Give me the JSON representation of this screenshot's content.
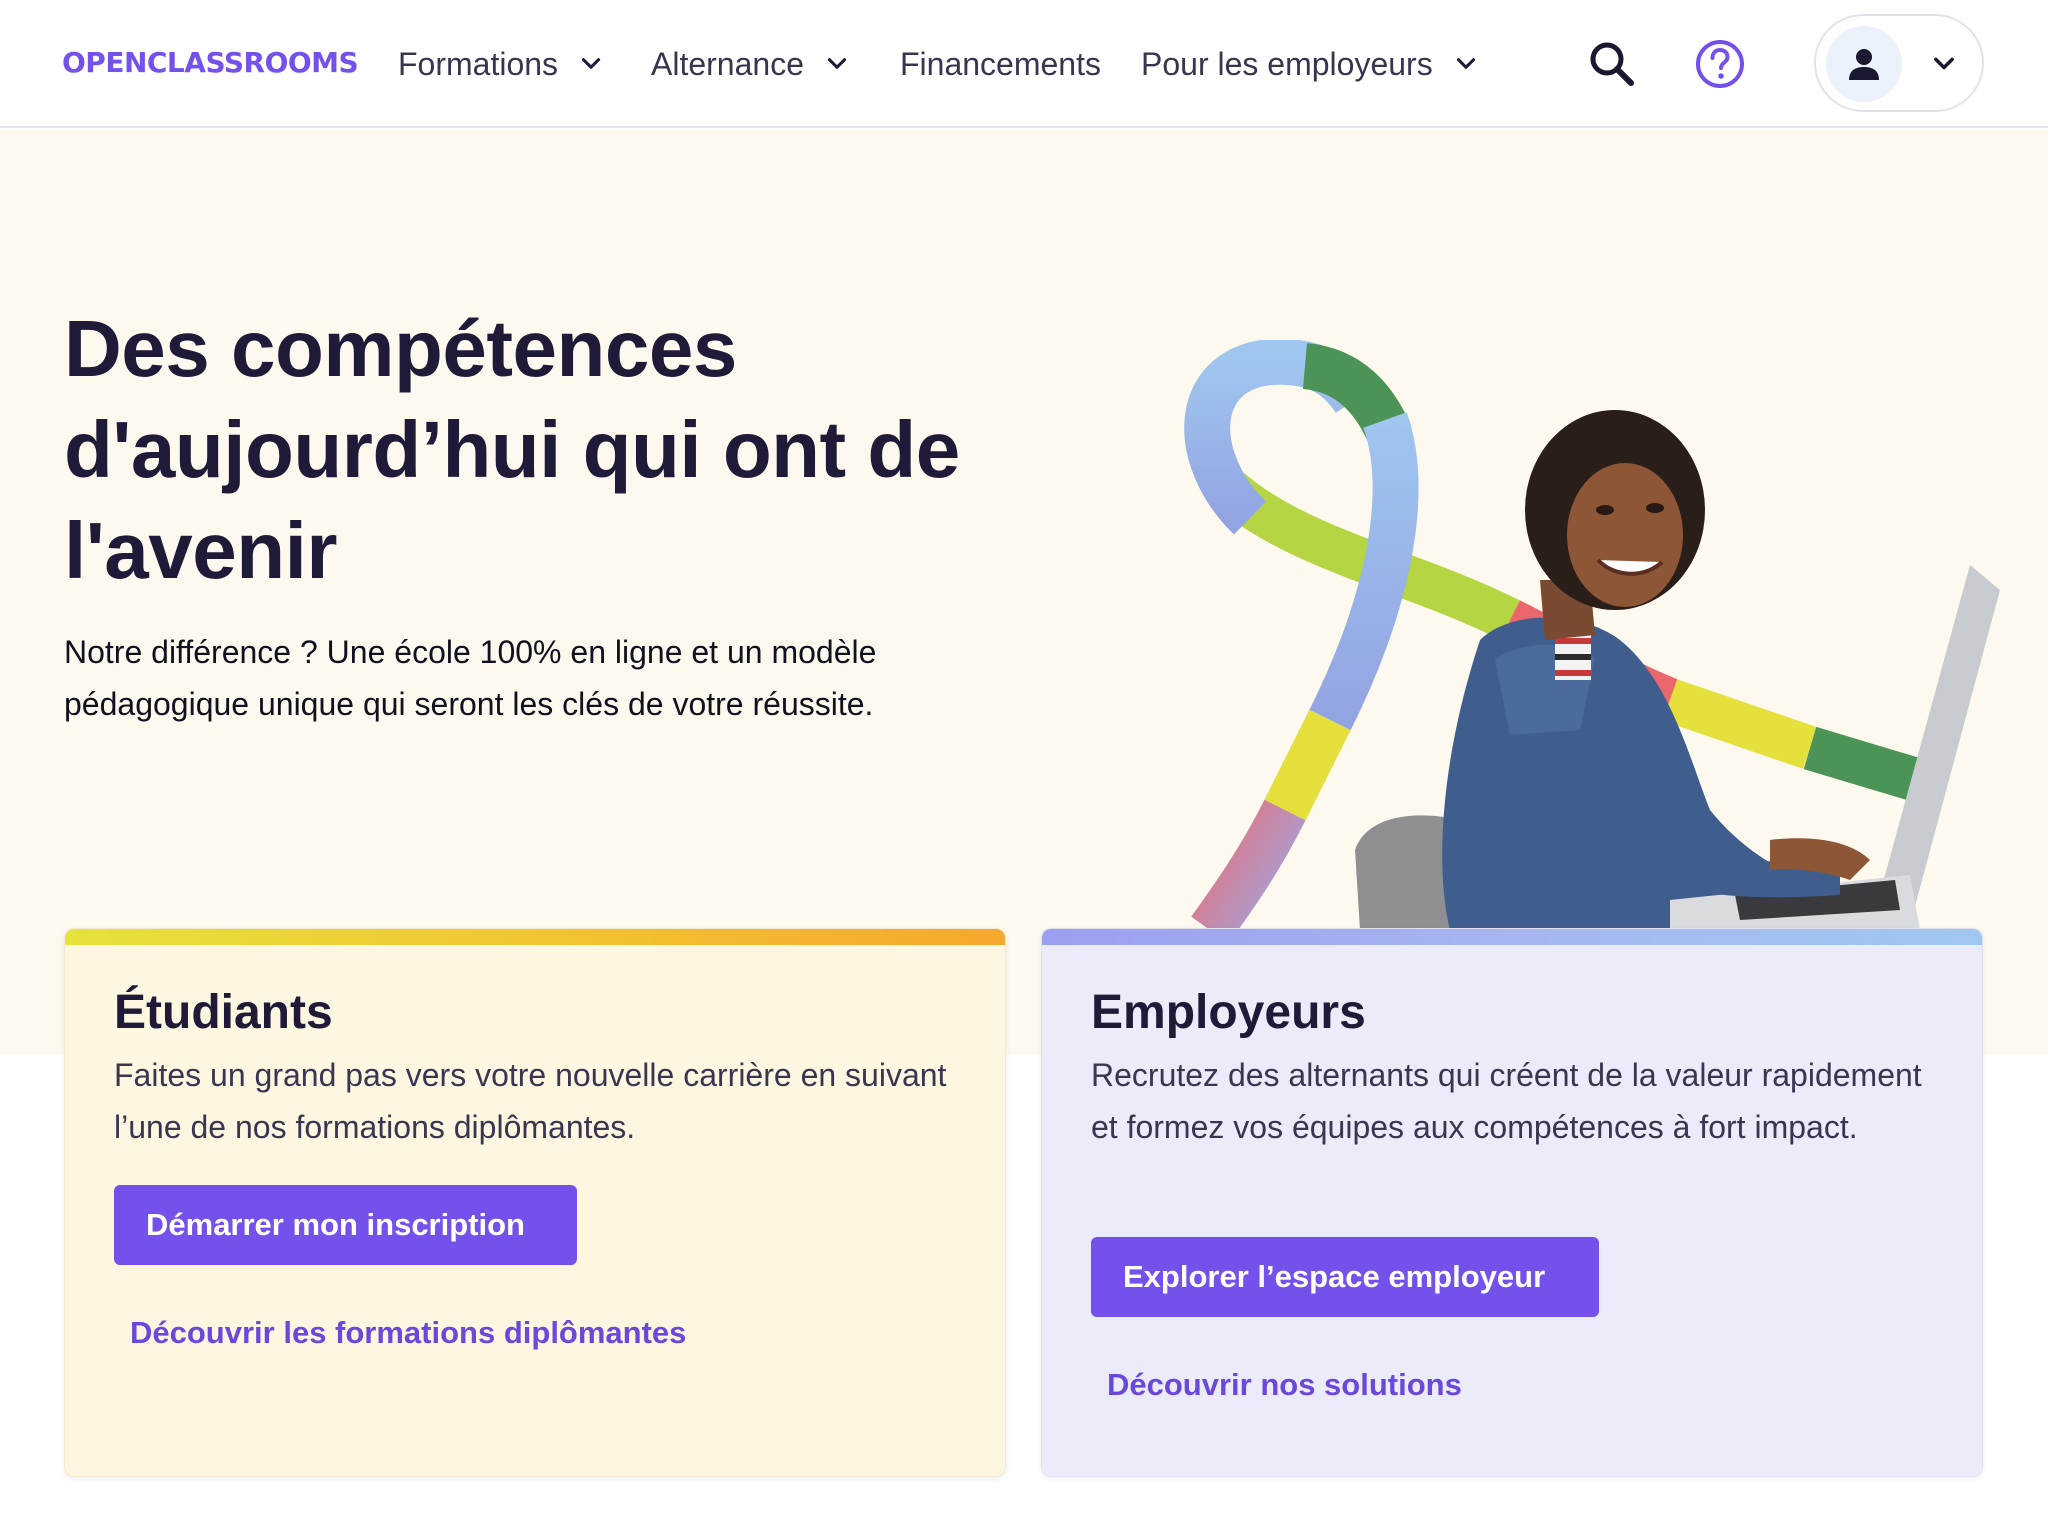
{
  "header": {
    "logo_text": "OPENCLASSROOMS",
    "nav": [
      {
        "label": "Formations",
        "has_dropdown": true
      },
      {
        "label": "Alternance",
        "has_dropdown": true
      },
      {
        "label": "Financements",
        "has_dropdown": false
      },
      {
        "label": "Pour les employeurs",
        "has_dropdown": true
      }
    ],
    "icons": {
      "search": "search-icon",
      "help": "help-circle-icon",
      "user": "user-icon",
      "dropdown": "chevron-down-icon"
    }
  },
  "hero": {
    "title": "Des compétences d'aujourd’hui qui ont de l'avenir",
    "subtitle": "Notre différence ? Une école 100% en ligne et un modèle pédagogique unique qui seront les clés de votre réussite."
  },
  "cards": {
    "students": {
      "title": "Étudiants",
      "text": "Faites un grand pas vers votre nouvelle carrière en suivant l’une de nos formations diplômantes.",
      "button": "Démarrer mon inscription",
      "link": "Découvrir les formations diplômantes"
    },
    "employers": {
      "title": "Employeurs",
      "text": "Recrutez des alternants qui créent de la valeur rapidement et formez vos équipes aux compétences à fort impact.",
      "button": "Explorer l’espace employeur",
      "link": "Découvrir nos solutions"
    }
  },
  "colors": {
    "brand": "#7451eb",
    "hero_bg": "#fdf9ee",
    "students_card_bg": "#fdf7e1",
    "employers_card_bg": "#ecebf9",
    "text_dark": "#1f1a38"
  }
}
